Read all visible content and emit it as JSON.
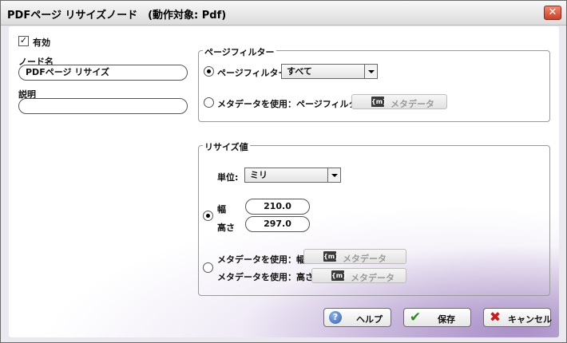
{
  "window": {
    "title": "PDFページ リサイズノード　(動作対象: Pdf)",
    "close_glyph": "✕"
  },
  "left": {
    "enabled_label": "有効",
    "enabled_checked": true,
    "check_glyph": "✓",
    "node_name_label": "ノード名",
    "node_name_value": "PDFページ リサイズ",
    "description_label": "説明",
    "description_value": ""
  },
  "page_filter": {
    "legend": "ページフィルター",
    "option_filter_label": "ページフィルター",
    "option_filter_selected": true,
    "filter_value": "すべて",
    "option_metadata_label": "メタデータを使用：ページフィルター",
    "metadata_button_label": "メタデータ",
    "metadata_icon_text": "{m}"
  },
  "resize": {
    "legend": "リサイズ値",
    "unit_label": "単位:",
    "unit_value": "ミリ",
    "width_label": "幅",
    "width_value": "210.0",
    "height_label": "高さ",
    "height_value": "297.0",
    "values_selected": true,
    "metadata_width_label": "メタデータを使用：幅",
    "metadata_height_label": "メタデータを使用：高さ",
    "metadata_button_label": "メタデータ",
    "metadata_icon_text": "{m}"
  },
  "buttons": {
    "help_label": "ヘルプ",
    "help_glyph": "?",
    "save_label": "保存",
    "save_glyph": "✔",
    "cancel_label": "キャンセル",
    "cancel_glyph": "✖"
  }
}
